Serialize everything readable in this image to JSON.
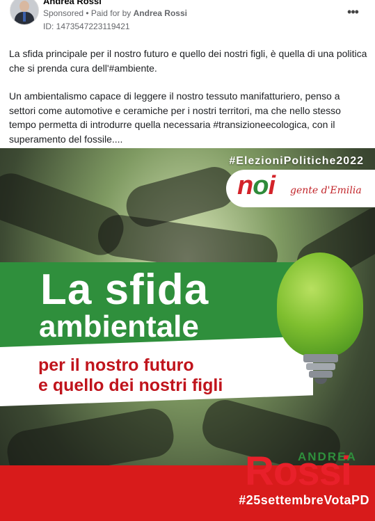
{
  "post": {
    "author": "Andrea Rossi",
    "sponsored": "Sponsored",
    "paid_for_prefix": " • Paid for by ",
    "paid_for_by": "Andrea Rossi",
    "ad_id": "ID: 1473547223119421",
    "more_icon": "more-options-icon",
    "paragraphs": [
      "La sfida principale per il nostro futuro e quello dei nostri figli, è quella di una politica che si prenda cura dell'#ambiente.",
      "Un ambientalismo capace di leggere il nostro tessuto manifatturiero, penso a settori come automotive e ceramiche per i nostri territori, ma che nello stesso tempo permetta di introdurre quella necessaria #transizioneecologica, con il superamento del fossile...."
    ]
  },
  "creative": {
    "hashtag_top": "#ElezioniPolitiche2022",
    "logo_n": "n",
    "logo_o": "o",
    "logo_i": "i",
    "logo_tagline": "gente d'Emilia",
    "title_line1": "La sfida",
    "title_line2": "ambientale",
    "subtitle_line1": "per il nostro futuro",
    "subtitle_line2": "e quello dei nostri figli",
    "candidate_first": "ANDREA",
    "candidate_last": "Rossi",
    "hashtag_bottom": "#25settembreVotaPD",
    "colors": {
      "green": "#2f8f3c",
      "red": "#d81b1b",
      "white": "#ffffff"
    }
  }
}
